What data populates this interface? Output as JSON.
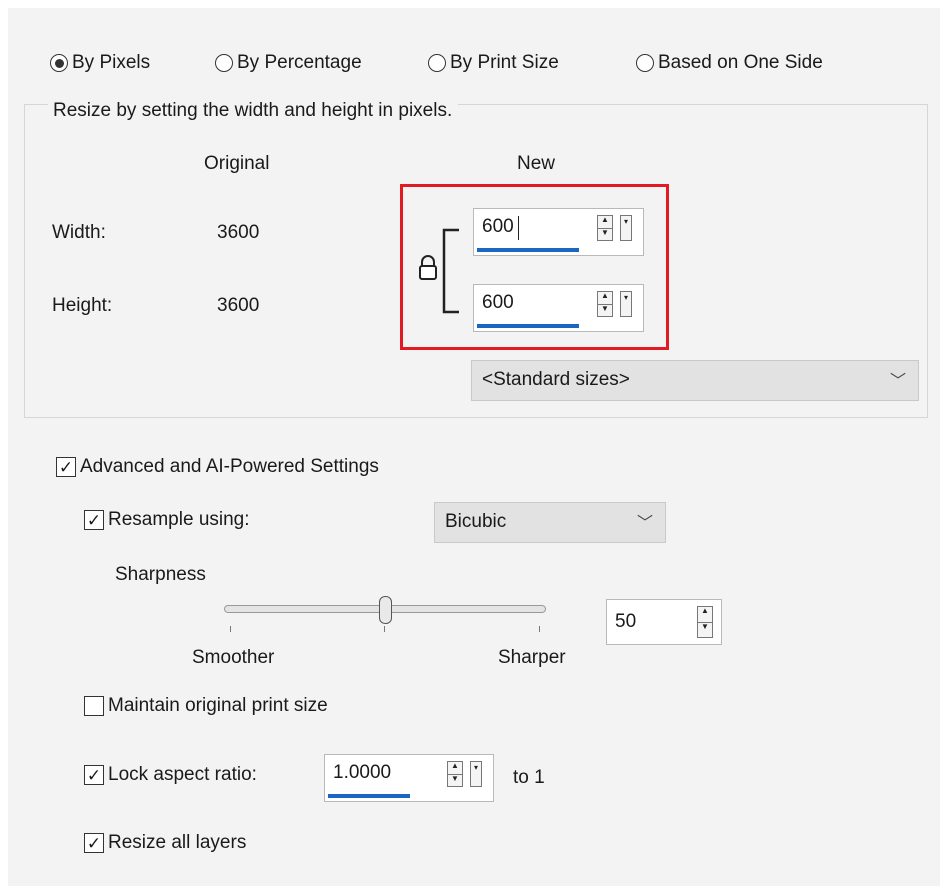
{
  "resize_mode": {
    "options": [
      "By Pixels",
      "By Percentage",
      "By Print Size",
      "Based on One Side"
    ],
    "selected": "By Pixels"
  },
  "pixel_group": {
    "caption": "Resize by setting the width and height in pixels.",
    "original_header": "Original",
    "new_header": "New",
    "width_label": "Width:",
    "height_label": "Height:",
    "original_width": "3600",
    "original_height": "3600",
    "new_width": "600",
    "new_height": "600",
    "standard_sizes": "<Standard sizes>"
  },
  "advanced": {
    "label": "Advanced and AI-Powered Settings",
    "checked": true,
    "resample_label": "Resample using:",
    "resample_checked": true,
    "resample_method": "Bicubic",
    "sharpness_label": "Sharpness",
    "sharpness_value": "50",
    "sharpness_level": 0.5,
    "smoother_label": "Smoother",
    "sharper_label": "Sharper",
    "maintain_print_label": "Maintain original print size",
    "maintain_print_checked": false,
    "lock_ratio_label": "Lock aspect ratio:",
    "lock_ratio_checked": true,
    "ratio_value": "1.0000",
    "ratio_suffix": "to 1",
    "resize_layers_label": "Resize all layers",
    "resize_layers_checked": true
  },
  "colors": {
    "highlight": "#e01b23",
    "focus_underline": "#1a66c2"
  },
  "icons": [
    "lock-icon",
    "spin-up-down-icon",
    "dropdown-arrow-icon",
    "chevron-down-icon",
    "checkmark-icon"
  ]
}
